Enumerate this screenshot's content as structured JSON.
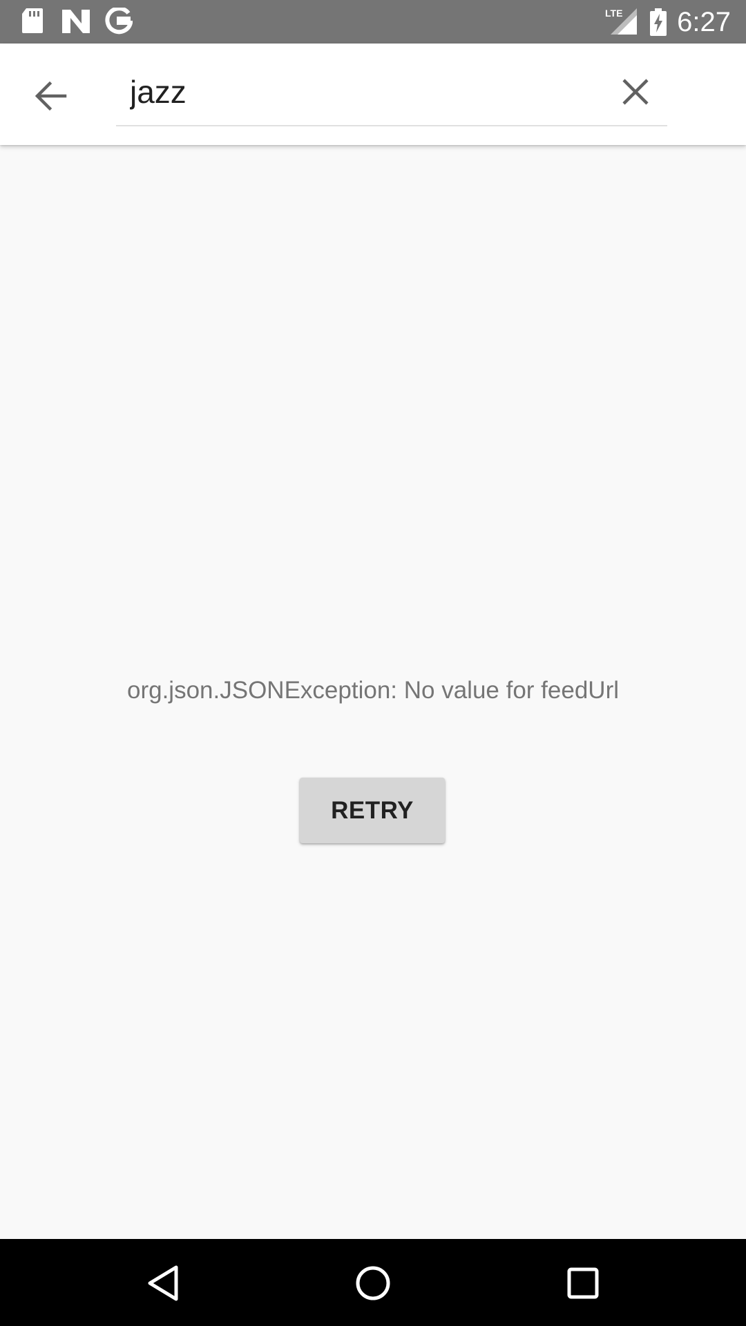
{
  "status_bar": {
    "time": "6:27",
    "network": "LTE",
    "icons": [
      "sd-card-icon",
      "n-icon",
      "google-g-icon",
      "lte-signal-icon",
      "battery-charging-icon"
    ]
  },
  "search": {
    "query": "jazz",
    "back_icon": "arrow-back-icon",
    "clear_icon": "close-icon"
  },
  "error": {
    "message": "org.json.JSONException: No value for feedUrl",
    "retry_label": "RETRY"
  },
  "nav_bar": {
    "icons": [
      "back-triangle-icon",
      "home-circle-icon",
      "recents-square-icon"
    ]
  },
  "colors": {
    "status_bar": "#757575",
    "toolbar": "#ffffff",
    "background": "#f9f9f9",
    "button": "#d6d6d6",
    "nav_bar": "#000000"
  }
}
